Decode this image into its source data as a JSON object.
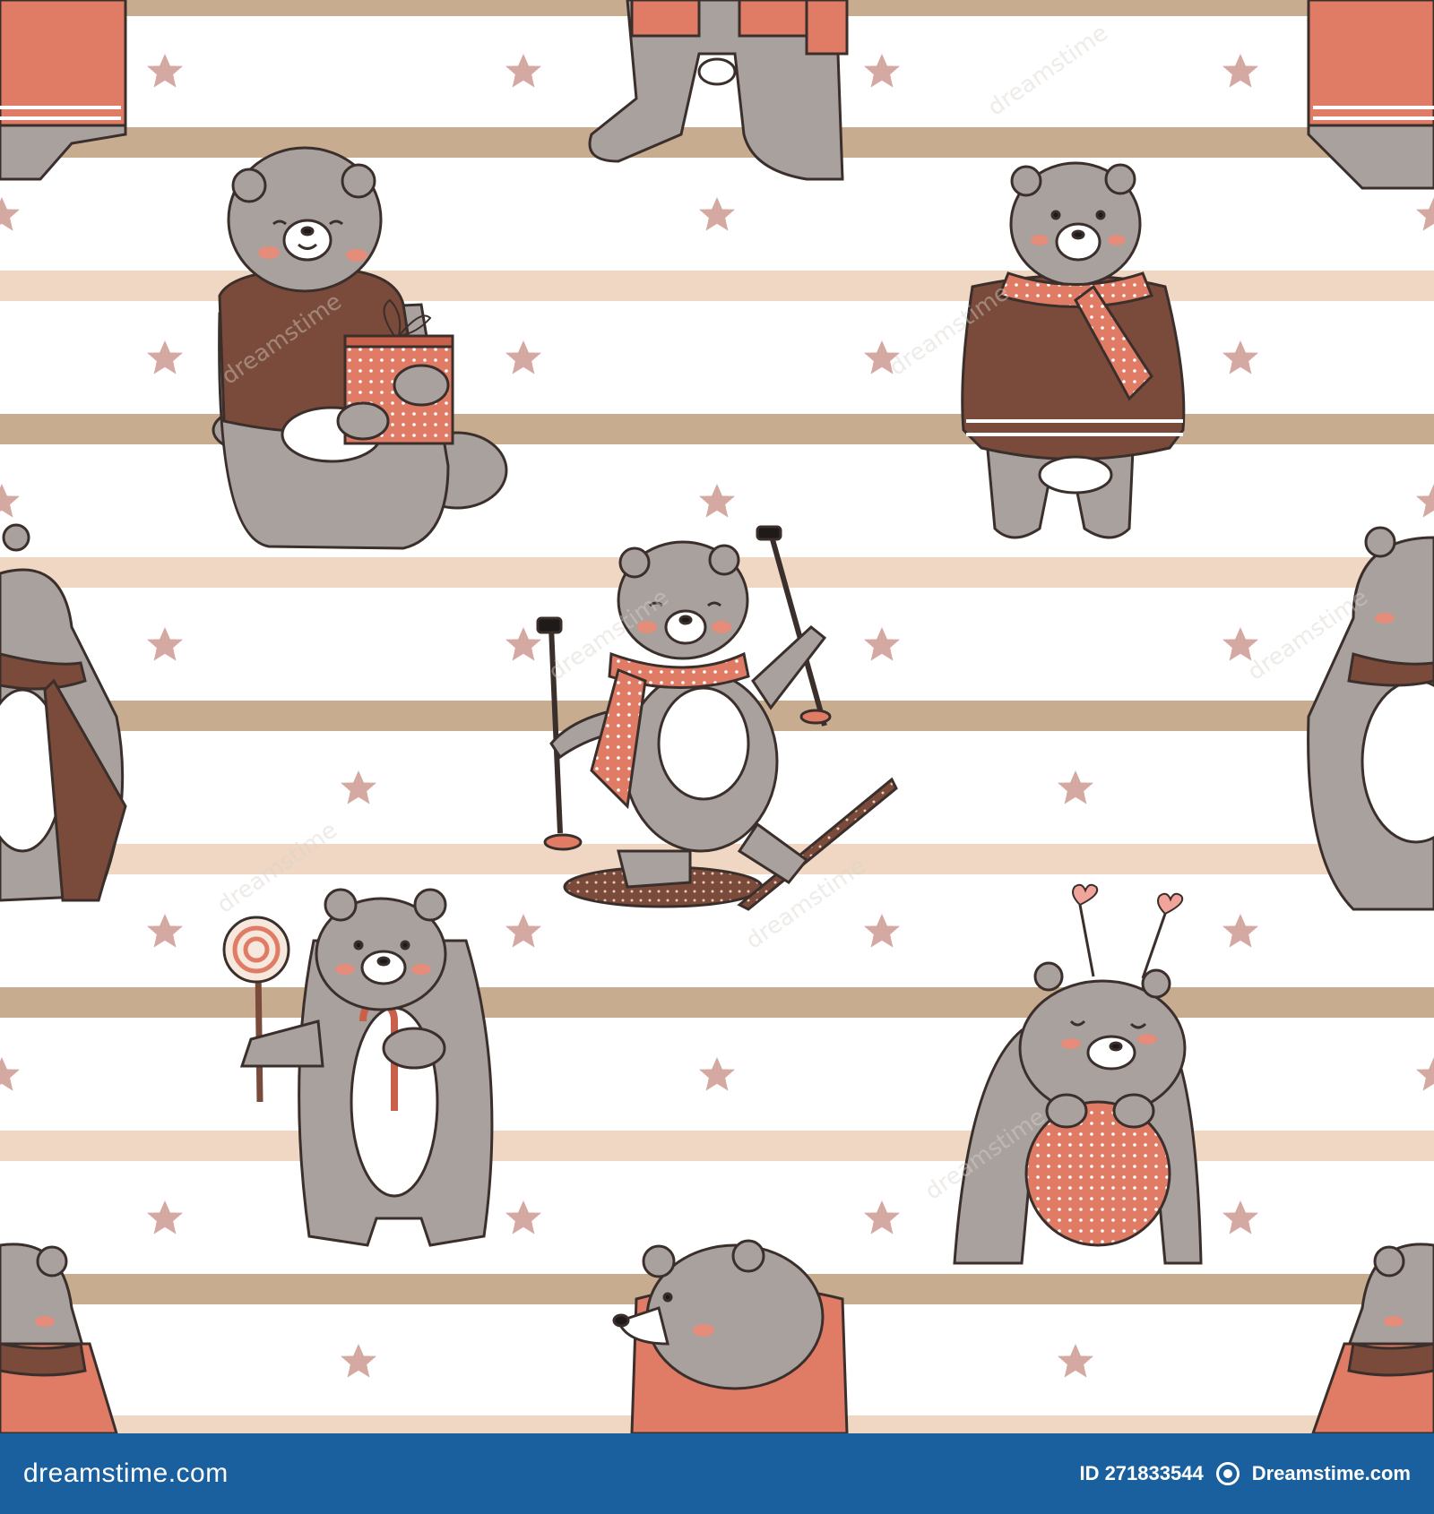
{
  "image": {
    "background": "#ffffff",
    "stripe_colors": [
      "#c8ac8f",
      "#efd7c3"
    ],
    "star_color": "#d4a9a1",
    "bear_fur": "#a9a19e",
    "accent_colors": {
      "coral": "#e07c66",
      "brown": "#7a4a3a",
      "cream": "#f7e8dd"
    },
    "description_tags": [
      "bears",
      "stars",
      "stripes",
      "scarf",
      "gift",
      "skis",
      "lollipop",
      "ball"
    ]
  },
  "watermark": {
    "text": "dreamstime"
  },
  "footer": {
    "logo": "dreamstime.com",
    "id_text": "ID 271833544",
    "credit": "Dreamstime.com",
    "background": "#1a5f9e"
  }
}
